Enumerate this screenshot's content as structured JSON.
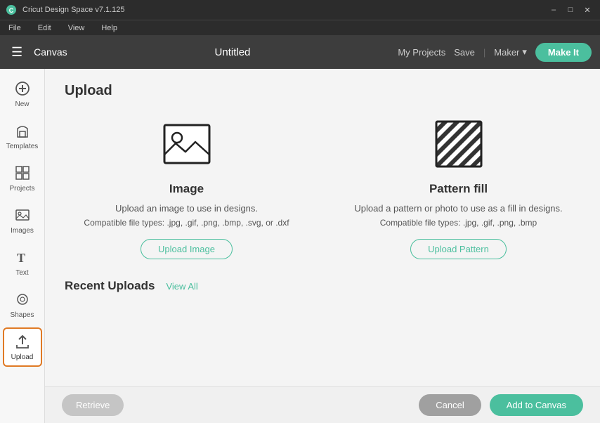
{
  "titlebar": {
    "app_name": "Cricut Design Space  v7.1.125",
    "minimize": "–",
    "maximize": "□",
    "close": "✕"
  },
  "menubar": {
    "items": [
      "File",
      "Edit",
      "View",
      "Help"
    ]
  },
  "header": {
    "menu_icon": "☰",
    "canvas_label": "Canvas",
    "project_title": "Untitled",
    "my_projects": "My Projects",
    "save": "Save",
    "maker": "Maker",
    "chevron": "▾",
    "make_it": "Make It"
  },
  "sidebar": {
    "items": [
      {
        "id": "new",
        "label": "New",
        "icon": "+"
      },
      {
        "id": "templates",
        "label": "Templates",
        "icon": "👕"
      },
      {
        "id": "projects",
        "label": "Projects",
        "icon": "⊞"
      },
      {
        "id": "images",
        "label": "Images",
        "icon": "🖼"
      },
      {
        "id": "text",
        "label": "Text",
        "icon": "T"
      },
      {
        "id": "shapes",
        "label": "Shapes",
        "icon": "◎"
      },
      {
        "id": "upload",
        "label": "Upload",
        "icon": "⬆",
        "active": true
      }
    ]
  },
  "upload": {
    "title": "Upload",
    "image_option": {
      "name": "Image",
      "description": "Upload an image to use in designs.",
      "compat": "Compatible file types: .jpg, .gif, .png, .bmp, .svg, or .dxf",
      "button": "Upload Image"
    },
    "pattern_option": {
      "name": "Pattern fill",
      "description": "Upload a pattern or photo to use as a fill in designs.",
      "compat": "Compatible file types: .jpg, .gif, .png, .bmp",
      "button": "Upload Pattern"
    },
    "recent_title": "Recent Uploads",
    "view_all": "View All"
  },
  "bottombar": {
    "retrieve_label": "Retrieve",
    "cancel_label": "Cancel",
    "add_canvas_label": "Add to Canvas"
  }
}
